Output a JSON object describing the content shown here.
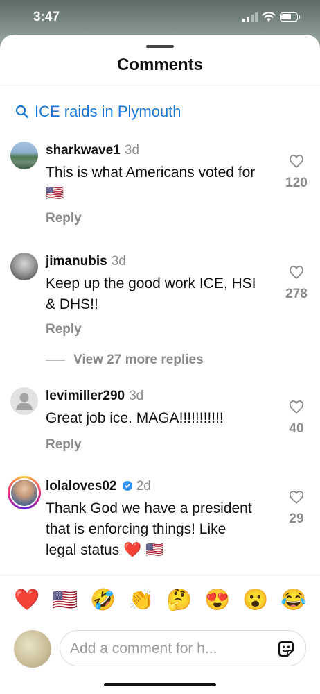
{
  "status_bar": {
    "time": "3:47",
    "battery_level": 0.7
  },
  "sheet": {
    "title": "Comments"
  },
  "search_suggestion": {
    "text": "ICE raids in Plymouth",
    "icon": "search-icon"
  },
  "comments": [
    {
      "username": "sharkwave1",
      "time": "3d",
      "text": "This is what Americans voted for 🇺🇸",
      "reply_label": "Reply",
      "likes": "120",
      "verified": false
    },
    {
      "username": "jimanubis",
      "time": "3d",
      "text": "Keep up the good work ICE, HSI & DHS!!",
      "reply_label": "Reply",
      "likes": "278",
      "verified": false
    },
    {
      "username": "levimiller290",
      "time": "3d",
      "text": "Great job ice.  MAGA!!!!!!!!!!!",
      "reply_label": "Reply",
      "likes": "40",
      "verified": false
    },
    {
      "username": "lolaloves02",
      "time": "2d",
      "text": "Thank God we have a president that is enforcing things! Like legal status ❤️ 🇺🇸",
      "likes": "29",
      "verified": true
    }
  ],
  "view_more_replies": "View 27 more replies",
  "emoji_bar": [
    "❤️",
    "🇺🇸",
    "🤣",
    "👏",
    "🤔",
    "😍",
    "😮",
    "😂"
  ],
  "composer": {
    "placeholder": "Add a comment for h..."
  },
  "colors": {
    "link_blue": "#1877d6",
    "secondary_text": "#8a8a8a",
    "verified_blue": "#2f8ff5"
  }
}
